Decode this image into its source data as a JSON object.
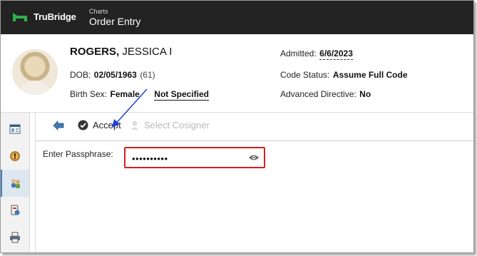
{
  "app": {
    "brand": "TruBridge",
    "breadcrumb": "Charts",
    "title": "Order Entry"
  },
  "patient": {
    "last_name": "ROGERS,",
    "first_name": "JESSICA I",
    "dob_label": "DOB:",
    "dob_value": "02/05/1963",
    "age": "(61)",
    "birth_sex_label": "Birth Sex:",
    "birth_sex_value": "Female",
    "gender_identity": "Not Specified",
    "admitted_label": "Admitted:",
    "admitted_value": "6/6/2023",
    "code_status_label": "Code Status:",
    "code_status_value": "Assume Full Code",
    "adv_directive_label": "Advanced Directive:",
    "adv_directive_value": "No"
  },
  "toolbar": {
    "accept_label": "Accept",
    "cosigner_label": "Select Cosigner"
  },
  "form": {
    "passphrase_label": "Enter Passphrase:",
    "passphrase_value": "••••••••••"
  },
  "sidebar": {
    "items": [
      {
        "icon": "chart-icon"
      },
      {
        "icon": "alert-icon"
      },
      {
        "icon": "people-icon"
      },
      {
        "icon": "medication-icon"
      },
      {
        "icon": "printer-icon"
      }
    ]
  },
  "colors": {
    "topbar": "#232323",
    "brand_green": "#2db34a",
    "highlight_red": "#d32020",
    "annotation_blue": "#1f3fd6"
  }
}
